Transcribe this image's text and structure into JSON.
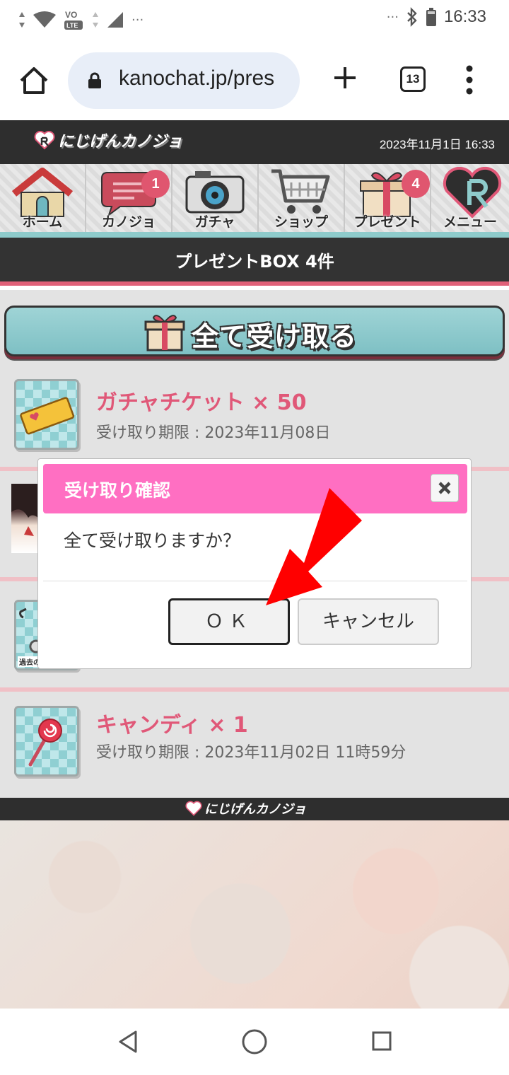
{
  "status_bar": {
    "time": "16:33",
    "overflow": "···"
  },
  "browser": {
    "url": "kanochat.jp/pres",
    "tab_count": "13"
  },
  "site": {
    "logo_text": "にじげんカノジョ",
    "date": "2023年11月1日 16:33"
  },
  "nav": [
    {
      "label": "ホーム",
      "icon": "home-icon",
      "badge": ""
    },
    {
      "label": "カノジョ",
      "icon": "chat-icon",
      "badge": "1"
    },
    {
      "label": "ガチャ",
      "icon": "camera-icon",
      "badge": ""
    },
    {
      "label": "ショップ",
      "icon": "cart-icon",
      "badge": ""
    },
    {
      "label": "プレゼント",
      "icon": "gift-icon",
      "badge": "4"
    },
    {
      "label": "メニュー",
      "icon": "heart-logo-icon",
      "badge": ""
    }
  ],
  "present": {
    "title": "プレゼントBOX 4件",
    "receive_all": "全て受け取る"
  },
  "items": [
    {
      "name": "ガチャチケット × 50",
      "limit": "受け取り期限 : 2023年11月08日",
      "icon": "ticket-icon"
    },
    {
      "name": "",
      "limit": "",
      "icon": "girl-card-icon"
    },
    {
      "name": "",
      "limit": "",
      "icon": "key-item-icon"
    },
    {
      "name": "キャンディ × 1",
      "limit": "受け取り期限 : 2023年11月02日 11時59分",
      "icon": "candy-icon"
    }
  ],
  "item_fragments": {
    "key_caption": "過去の"
  },
  "dialog": {
    "title": "受け取り確認",
    "message": "全て受け取りますか？",
    "ok": "ＯＫ",
    "cancel": "キャンセル"
  },
  "colors": {
    "accent": "#e05878",
    "dialog_header": "#ff6fc2",
    "header_dark": "#2e2e2e",
    "nav_stripe": "#8ecbcb",
    "arrow": "#ff0000"
  }
}
